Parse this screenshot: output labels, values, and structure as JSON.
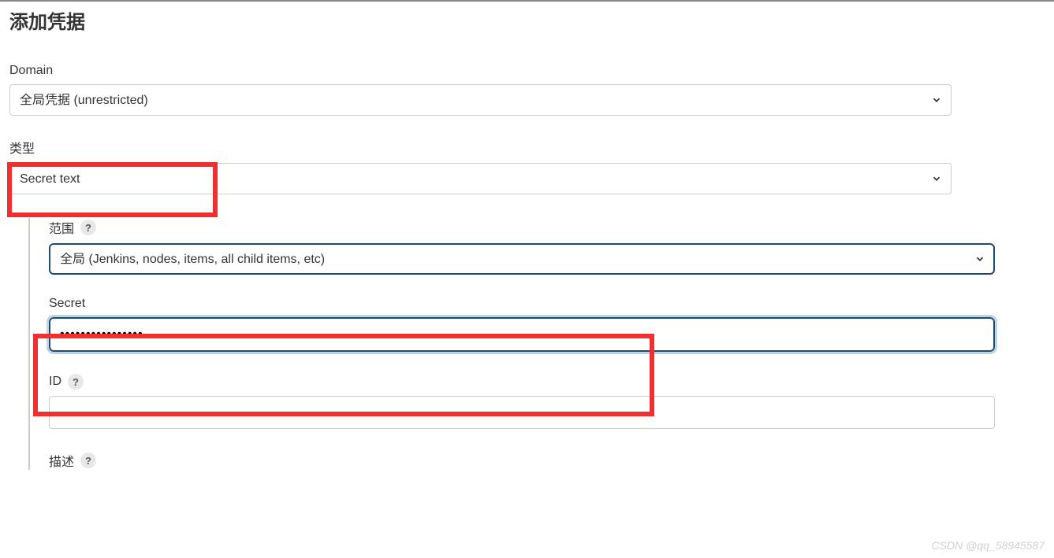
{
  "page": {
    "title": "添加凭据"
  },
  "fields": {
    "domain": {
      "label": "Domain",
      "value": "全局凭据 (unrestricted)"
    },
    "type": {
      "label": "类型",
      "value": "Secret text"
    },
    "scope": {
      "label": "范围",
      "value": "全局 (Jenkins, nodes, items, all child items, etc)"
    },
    "secret": {
      "label": "Secret",
      "value": "••••••••••••••••"
    },
    "id": {
      "label": "ID",
      "value": ""
    },
    "description": {
      "label": "描述"
    }
  },
  "help": {
    "badge": "?"
  },
  "watermark": "CSDN @qq_58945587"
}
